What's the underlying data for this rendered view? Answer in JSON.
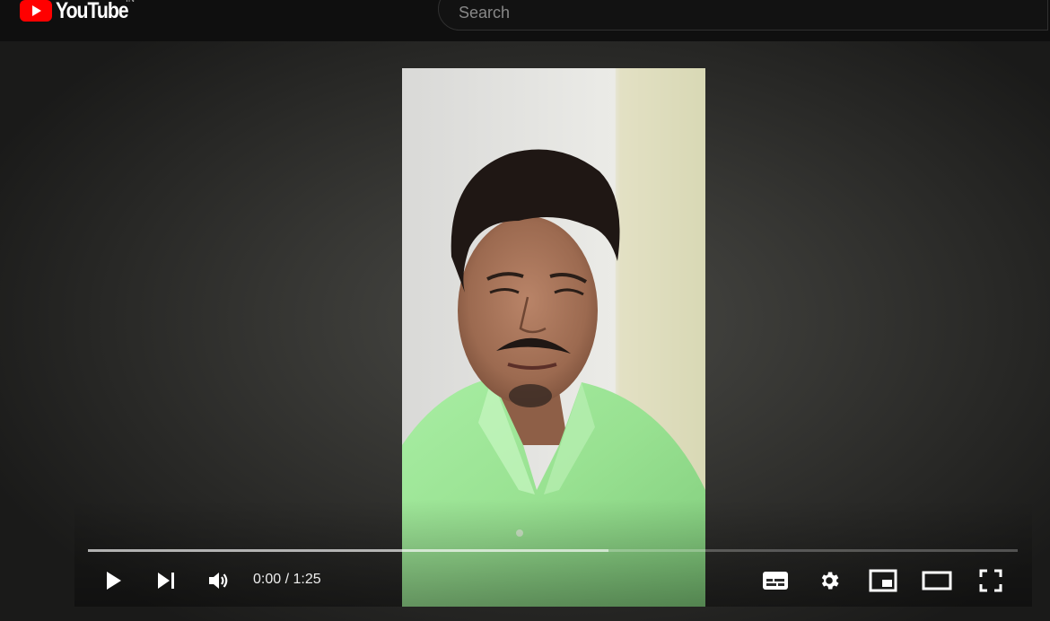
{
  "header": {
    "logo_text": "YouTube",
    "region": "IN",
    "search_placeholder": "Search"
  },
  "player": {
    "current_time": "0:00",
    "separator": "/",
    "duration": "1:25",
    "buffered_fraction": 0.56,
    "played_fraction": 0.0
  },
  "icons": {
    "play": "play-icon",
    "next": "next-icon",
    "volume": "volume-icon",
    "subtitles": "subtitles-icon",
    "settings": "gear-icon",
    "miniplayer": "miniplayer-icon",
    "theater": "theater-mode-icon",
    "fullscreen": "fullscreen-icon"
  },
  "colors": {
    "brand_red": "#ff0000",
    "background": "#0f0f0f",
    "shirt_green": "#9ee39a"
  }
}
